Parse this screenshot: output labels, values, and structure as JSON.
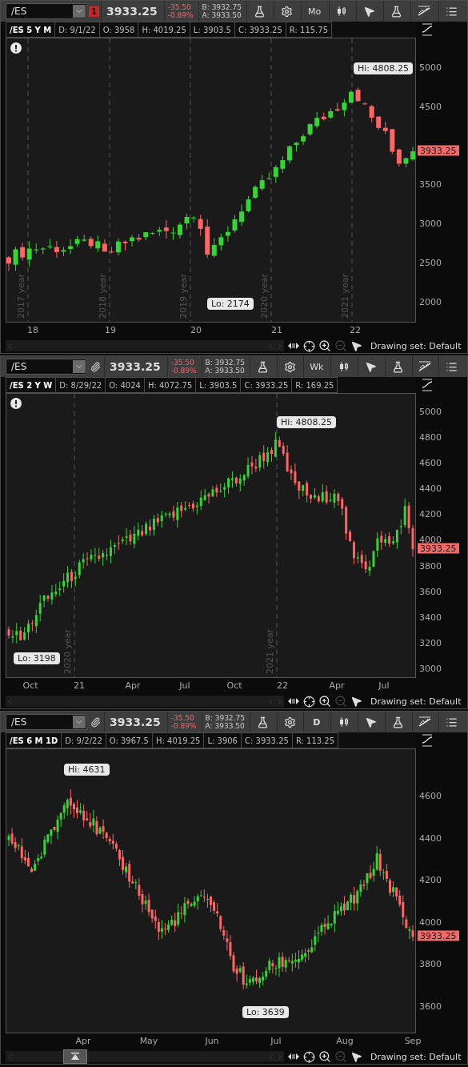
{
  "panels": [
    {
      "symbol": "/ES",
      "link": {
        "kind": "badge",
        "label": "1"
      },
      "price": "3933.25",
      "change": "-35.50",
      "change_percent": "-0.89%",
      "bid": "B: 3932.75",
      "ask": "A: 3933.50",
      "aggregation": "Mo",
      "info": [
        "/ES 5 Y M",
        "D: 9/1/22",
        "O: 3958",
        "H: 4019.25",
        "L: 3903.5",
        "C: 3933.25",
        "R: 115.75"
      ],
      "alert": true,
      "y_labels": [
        "5000",
        "4500",
        "3500",
        "3000",
        "2500",
        "2000"
      ],
      "price_tag": "3933.25",
      "x_labels": [
        "18",
        "19",
        "20",
        "21",
        "22"
      ],
      "separators": [
        "2017 year",
        "2018 year",
        "2019 year",
        "2020 year",
        "2021 year"
      ],
      "high": "Hi: 4808.25",
      "low": "Lo: 2174",
      "scroll_thumb": false,
      "drawing_set": "Drawing set: Default"
    },
    {
      "symbol": "/ES",
      "link": {
        "kind": "link"
      },
      "price": "3933.25",
      "change": "-35.50",
      "change_percent": "-0.89%",
      "bid": "B: 3932.75",
      "ask": "A: 3933.50",
      "aggregation": "Wk",
      "info": [
        "/ES 2 Y W",
        "D: 8/29/22",
        "O: 4024",
        "H: 4072.75",
        "L: 3903.5",
        "C: 3933.25",
        "R: 169.25"
      ],
      "alert": true,
      "y_labels": [
        "5000",
        "4800",
        "4600",
        "4400",
        "4200",
        "4000",
        "3800",
        "3600",
        "3400",
        "3200",
        "3000"
      ],
      "price_tag": "3933.25",
      "x_labels": [
        "Oct",
        "21",
        "Apr",
        "Jul",
        "Oct",
        "22",
        "Apr",
        "Jul"
      ],
      "separators": [
        "2020 year",
        "2021 year"
      ],
      "high": "Hi: 4808.25",
      "low": "Lo: 3198",
      "scroll_thumb": false,
      "drawing_set": "Drawing set: Default"
    },
    {
      "symbol": "/ES",
      "link": {
        "kind": "link"
      },
      "price": "3933.25",
      "change": "-35.50",
      "change_percent": "-0.89%",
      "bid": "B: 3932.75",
      "ask": "A: 3933.50",
      "aggregation": "D",
      "info": [
        "/ES 6 M 1D",
        "D: 9/2/22",
        "O: 3967.5",
        "H: 4019.25",
        "L: 3906",
        "C: 3933.25",
        "R: 113.25"
      ],
      "alert": false,
      "y_labels": [
        "4600",
        "4400",
        "4200",
        "4000",
        "3800",
        "3600"
      ],
      "price_tag": "3933.25",
      "x_labels": [
        "Apr",
        "May",
        "Jun",
        "Jul",
        "Aug",
        "Sep"
      ],
      "high": "Hi: 4631",
      "low": "Lo: 3639",
      "scroll_thumb": true,
      "drawing_set": "Drawing set: Default"
    }
  ]
}
